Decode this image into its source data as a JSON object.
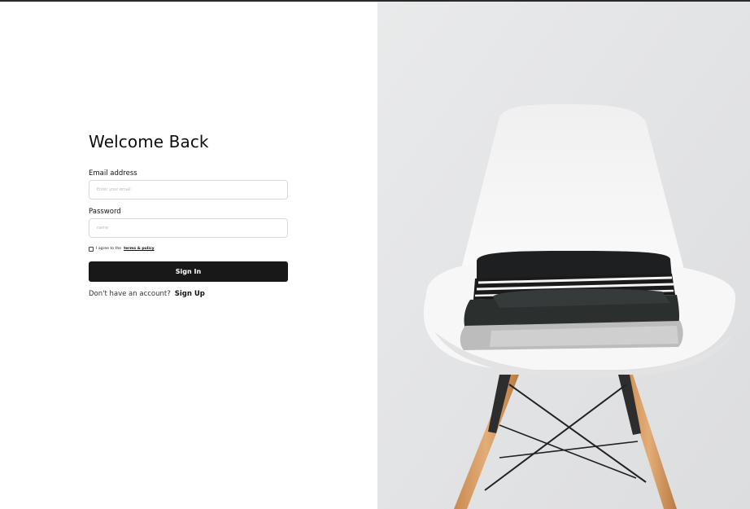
{
  "login": {
    "title": "Welcome Back",
    "email_label": "Email address",
    "email_placeholder": "Enter your email",
    "email_value": "",
    "password_label": "Password",
    "password_placeholder": "name",
    "password_value": "",
    "terms_prefix": "I agree to the",
    "terms_link": "terms & policy",
    "terms_checked": false,
    "signin_label": "Sign In",
    "signup_prompt": "Don't have an account?",
    "signup_link": "Sign Up"
  },
  "hero_image": {
    "description_icon": "chair-with-folded-clothes-photo"
  },
  "colors": {
    "primary_button": "#181818",
    "background": "#ffffff",
    "photo_background": "#e6e7e8"
  }
}
